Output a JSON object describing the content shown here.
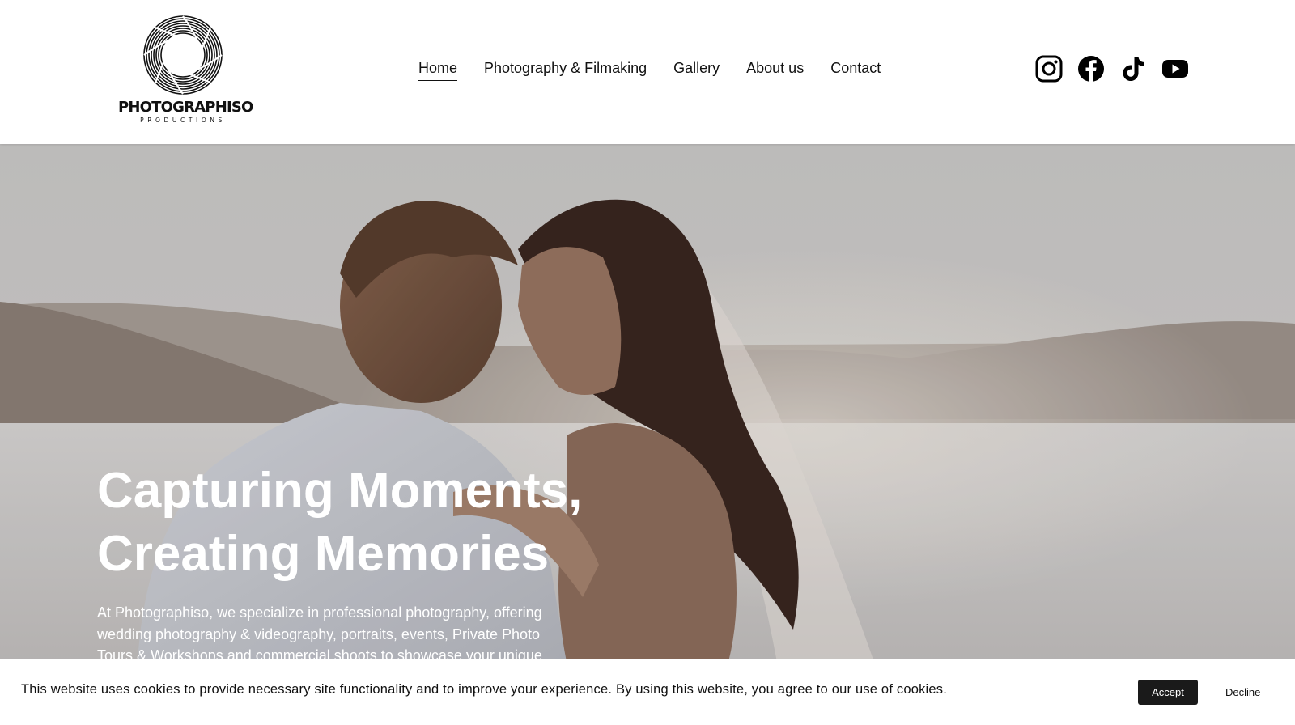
{
  "brand": {
    "name": "PHOTOGRAPHISO",
    "tagline": "PRODUCTIONS"
  },
  "nav": {
    "items": [
      {
        "label": "Home",
        "active": true
      },
      {
        "label": "Photography & Filmaking",
        "active": false
      },
      {
        "label": "Gallery",
        "active": false
      },
      {
        "label": "About us",
        "active": false
      },
      {
        "label": "Contact",
        "active": false
      }
    ]
  },
  "social": {
    "icons": [
      "instagram-icon",
      "facebook-icon",
      "tiktok-icon",
      "youtube-icon"
    ]
  },
  "hero": {
    "title_line1": "Capturing Moments,",
    "title_line2": "Creating Memories",
    "text": "At Photographiso, we specialize in professional photography, offering wedding photography & videography, portraits, events, Private Photo Tours & Workshops and commercial shoots to showcase your unique"
  },
  "cookie": {
    "message": "This website uses cookies to provide necessary site functionality and to improve your experience. By using this website, you agree to our use of cookies.",
    "accept_label": "Accept",
    "decline_label": "Decline"
  },
  "colors": {
    "accept_bg": "#1a1a1a",
    "text": "#111111",
    "hero_overlay_text": "#ffffff"
  }
}
